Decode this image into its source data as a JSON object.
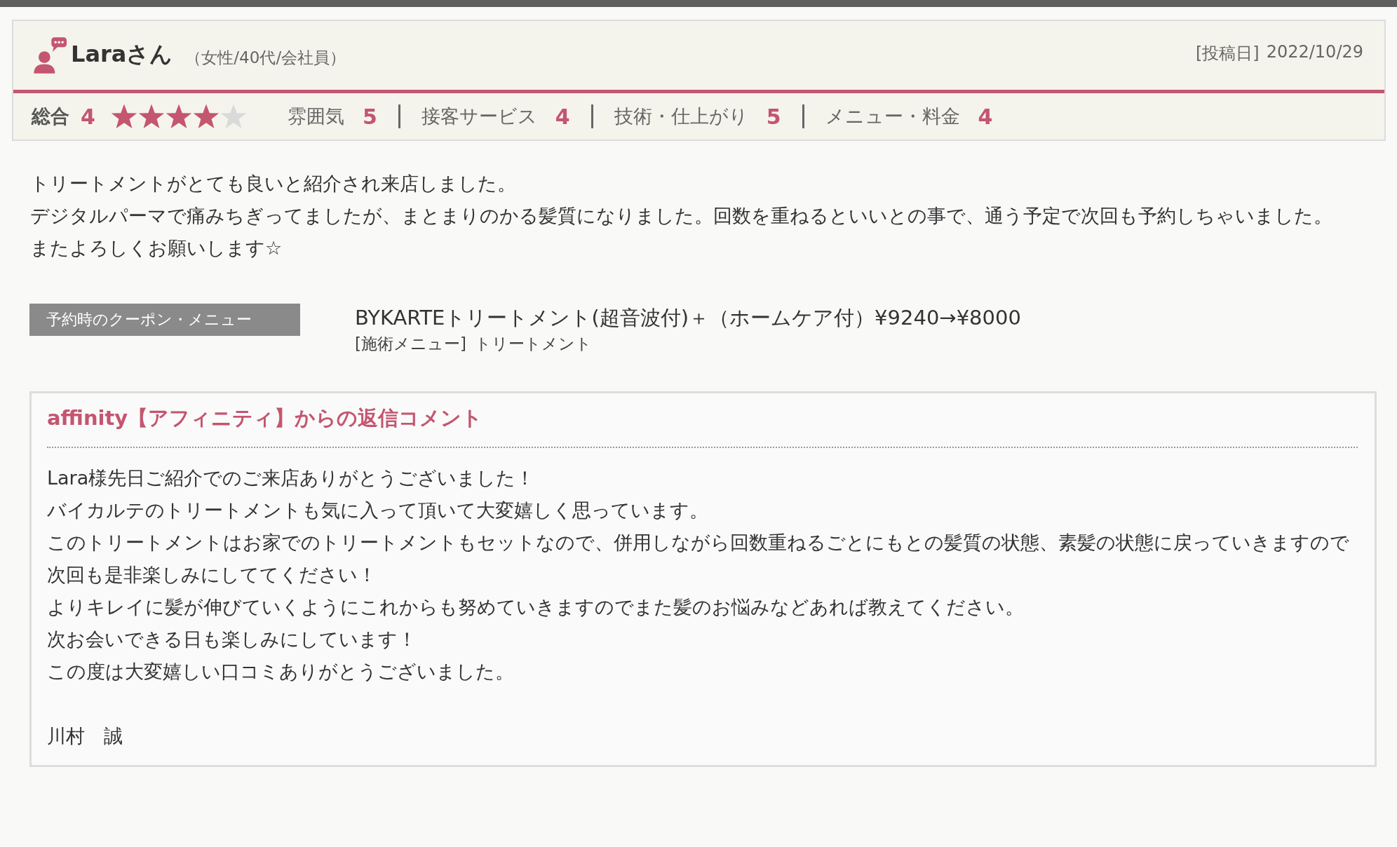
{
  "review": {
    "reviewer": "Laraさん",
    "profile": "（女性/40代/会社員）",
    "posted_label": "[投稿日]",
    "posted_date": "2022/10/29",
    "overall": {
      "label": "総合",
      "score": "4",
      "stars": 4
    },
    "categories": [
      {
        "name": "雰囲気",
        "score": "5"
      },
      {
        "name": "接客サービス",
        "score": "4"
      },
      {
        "name": "技術・仕上がり",
        "score": "5"
      },
      {
        "name": "メニュー・料金",
        "score": "4"
      }
    ],
    "body": [
      "トリートメントがとても良いと紹介され来店しました。",
      "デジタルパーマで痛みちぎってましたが、まとまりのかる髪質になりました。回数を重ねるといいとの事で、通う予定で次回も予約しちゃいました。",
      "またよろしくお願いします☆"
    ],
    "coupon": {
      "label": "予約時のクーポン・メニュー",
      "name": "BYKARTEトリートメント(超音波付)＋（ホームケア付）¥9240→¥8000",
      "menu_label": "[施術メニュー]",
      "menu": "トリートメント"
    }
  },
  "reply": {
    "title": "affinity【アフィニティ】からの返信コメント",
    "lines": [
      "Lara様先日ご紹介でのご来店ありがとうございました！",
      "バイカルテのトリートメントも気に入って頂いて大変嬉しく思っています。",
      "このトリートメントはお家でのトリートメントもセットなので、併用しながら回数重ねるごとにもとの髪質の状態、素髪の状態に戻っていきますので次回も是非楽しみにしててください！",
      "よりキレイに髪が伸びていくようにこれからも努めていきますのでまた髪のお悩みなどあれば教えてください。",
      "次お会いできる日も楽しみにしています！",
      "この度は大変嬉しい口コミありがとうございました。"
    ],
    "signature": "川村　誠"
  }
}
